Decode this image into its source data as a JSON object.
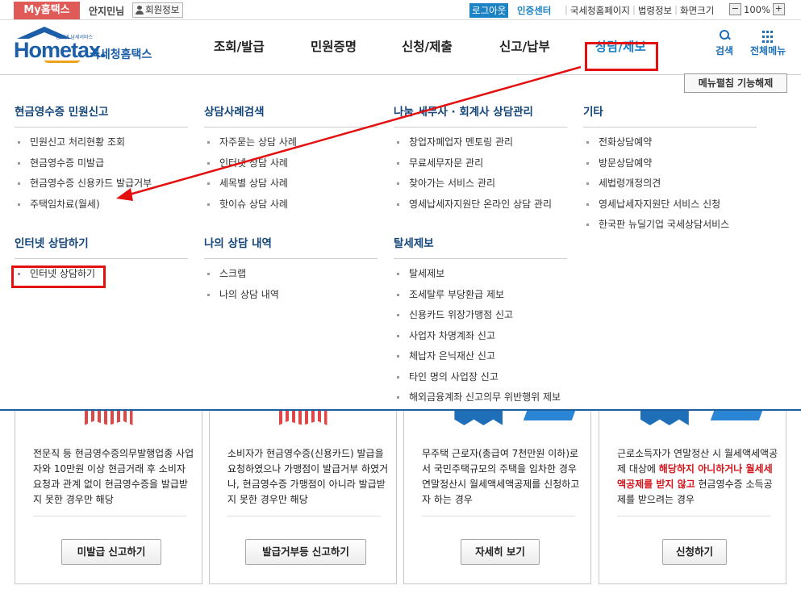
{
  "util": {
    "my_tab": "My홈택스",
    "greeting": "안지민님",
    "member_info": "회원정보",
    "logout": "로그아웃",
    "auth_center": "인증센터",
    "links": [
      "국세청홈페이지",
      "법령정보",
      "화면크기"
    ],
    "zoom_minus": "−",
    "zoom_level": "100%",
    "zoom_plus": "+"
  },
  "header": {
    "logo_small": "인터넷 납세서비스",
    "logo_word_a": "Home",
    "logo_word_b": "tax.",
    "logo_korean": "국세청홈택스",
    "nav": [
      "조회/발급",
      "민원증명",
      "신청/제출",
      "신고/납부",
      "상담/제보"
    ],
    "active_nav": "상담/제보",
    "search_label": "검색",
    "allmenu_label": "전체메뉴"
  },
  "panel": {
    "toggle_label": "메뉴펼침 기능해제",
    "col1": {
      "sec1": {
        "title": "현금영수증 민원신고",
        "items": [
          "민원신고 처리현황 조회",
          "현금영수증 미발급",
          "현금영수증 신용카드 발급거부",
          "주택임차료(월세)"
        ]
      },
      "sec2": {
        "title": "인터넷 상담하기",
        "items": [
          "인터넷 상담하기"
        ]
      }
    },
    "col2": {
      "sec1": {
        "title": "상담사례검색",
        "items": [
          "자주묻는 상담 사례",
          "인터넷 상담 사례",
          "세목별 상담 사례",
          "핫이슈 상담 사례"
        ]
      },
      "sec2": {
        "title": "나의 상담 내역",
        "items": [
          "스크랩",
          "나의 상담 내역"
        ]
      }
    },
    "col3": {
      "sec1": {
        "title": "나눔 세무사 · 회계사 상담관리",
        "items": [
          "창업자폐업자 멘토링 관리",
          "무료세무자문 관리",
          "찾아가는 서비스 관리",
          "영세납세자지원단 온라인 상담 관리"
        ]
      },
      "sec2": {
        "title": "탈세제보",
        "items": [
          "탈세제보",
          "조세탈루 부당환급 제보",
          "신용카드 위장가맹점 신고",
          "사업자 차명계좌 신고",
          "체납자 은닉재산 신고",
          "타인 명의 사업장 신고",
          "해외금융계좌 신고의무 위반행위 제보"
        ]
      }
    },
    "col4": {
      "sec1": {
        "title": "기타",
        "items": [
          "전화상담예약",
          "방문상담예약",
          "세법령개정의견",
          "영세납세자지원단 서비스 신청",
          "한국판 뉴딜기업 국세상담서비스"
        ]
      }
    }
  },
  "cards": [
    {
      "text": "전문직 등 현금영수증의무발행업종 사업자와 10만원 이상 현금거래 후 소비자 요청과 관계 없이 현금영수증을 발급받지 못한 경우만 해당",
      "button": "미발급 신고하기"
    },
    {
      "text": "소비자가 현금영수증(신용카드) 발급을 요청하였으나 가맹점이 발급거부 하였거나, 현금영수증 가맹점이 아니라 발급받지 못한 경우만 해당",
      "button": "발급거부등 신고하기"
    },
    {
      "text": "무주택 근로자(총급여 7천만원 이하)로서 국민주택규모의 주택을 임차한 경우 연말정산시 월세액세액공제를 신청하고자 하는 경우",
      "button": "자세히 보기"
    },
    {
      "text_a": "근로소득자가 연말정산 시 월세액세액공제 대상에 ",
      "text_em": "해당하지 아니하거나 월세세액공제를 받지 않고",
      "text_b": " 현금영수증 소득공제를 받으려는 경우",
      "button": "신청하기"
    }
  ],
  "colors": {
    "accent_blue": "#1b7fc4",
    "title_navy": "#14467a",
    "highlight_red": "#e40f0f",
    "my_tab": "#e05a58"
  }
}
